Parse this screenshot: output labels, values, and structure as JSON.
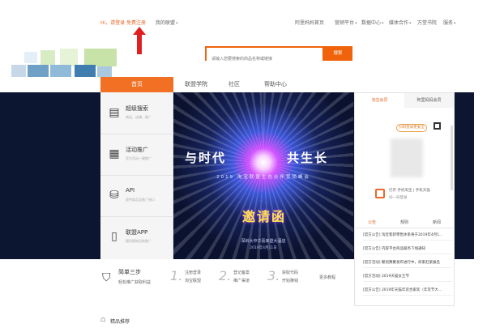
{
  "topbar": {
    "greeting": "Hi，请登录",
    "signup": "免费注册",
    "my_union": "我的联盟",
    "right_links": [
      "阿里妈妈首页",
      "营销平台",
      "数据中心",
      "媒体合作",
      "万堂书院",
      "服务"
    ]
  },
  "search": {
    "placeholder": "请输入您要搜索的商品名称或链接",
    "button": "搜索"
  },
  "nav": {
    "items": [
      "首页",
      "联盟学院",
      "社区",
      "帮助中心"
    ]
  },
  "left_menu": [
    {
      "title": "超级搜索",
      "sub": "商品、店铺、推广",
      "icon": "search-doc-icon"
    },
    {
      "title": "活动推广",
      "sub": "官方活动一键推广",
      "icon": "activity-icon"
    },
    {
      "title": "API",
      "sub": "提供商品及推广接口",
      "icon": "database-icon"
    },
    {
      "title": "联盟APP",
      "sub": "随时随地玩转推广",
      "icon": "phone-icon"
    }
  ],
  "banner": {
    "title_left": "与时代",
    "title_right": "共生长",
    "subtitle": "2019 淘宝联盟生态伙伴营销峰会",
    "invite": "邀请函",
    "date_line1": "深圳大中华喜来登大酒店",
    "date_line2": "2019年4月11日"
  },
  "right_panel": {
    "tabs": [
      "淘宝会员",
      "阿里妈妈会员"
    ],
    "badge": "扫码登录更安全",
    "scan_line1": "打开 手机淘宝 | 手机天猫",
    "scan_line2": "扫一扫登录",
    "news_tabs": [
      "公告",
      "规则",
      "新闻"
    ],
    "news": [
      "[官方公告] 淘宝客新零售体系将于2019年4月1...",
      "[官方公告] 内容平台商品服务下线通知",
      "[官方活动] 聚划算聚发布进行中，商家赶紧报名",
      "[官方活动] 2019天猫女王节",
      "[官方公告] 2019年天猫年货合家欢（年货节大..."
    ]
  },
  "steps": {
    "title": "简单三步",
    "subtitle": "轻松推广获取利益",
    "items": [
      {
        "num": "1.",
        "line1": "注册登录",
        "line2": "淘宝联盟"
      },
      {
        "num": "2.",
        "line1": "登记备案",
        "line2": "推广渠道"
      },
      {
        "num": "3.",
        "line1": "获取代码",
        "line2": "开始赚钱"
      }
    ],
    "more": "更多教程"
  },
  "bottom": {
    "label": "精品推荐"
  },
  "colors": {
    "accent": "#f0630a",
    "dark_band": "#0d1630"
  }
}
